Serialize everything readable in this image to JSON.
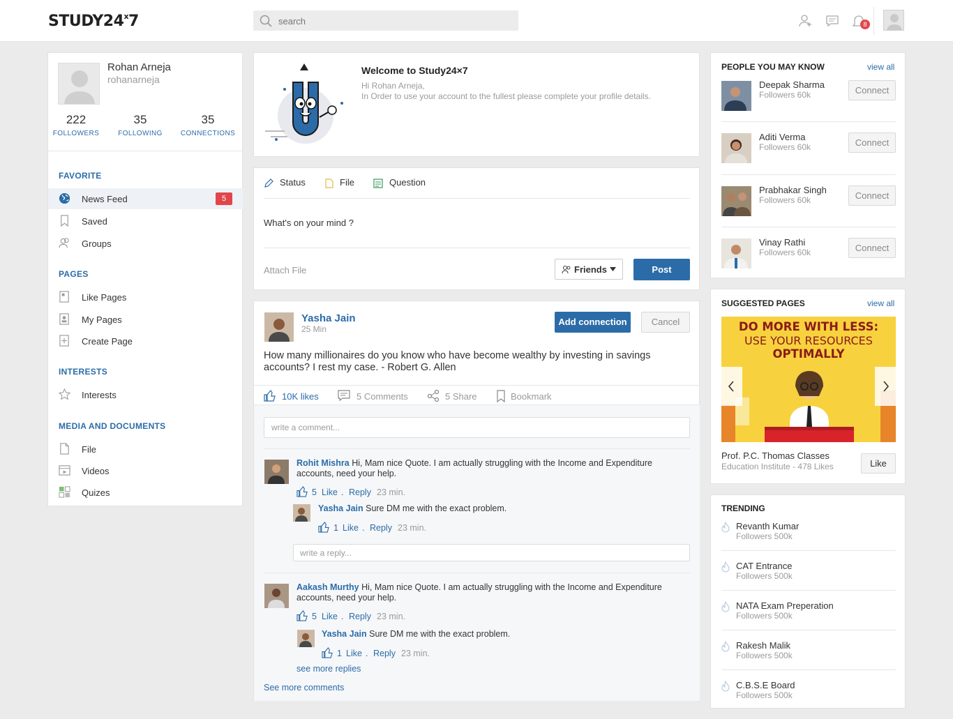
{
  "header": {
    "logo": "STUDY24",
    "logo_sup": "x",
    "logo_end": "7",
    "search_placeholder": "search",
    "notification_count": "8"
  },
  "profile": {
    "name": "Rohan Arneja",
    "username": "rohanarneja",
    "followers": "222",
    "followers_label": "FOLLOWERS",
    "following": "35",
    "following_label": "FOLLOWING",
    "connections": "35",
    "connections_label": "CONNECTIONS"
  },
  "sidebar": {
    "favorite_title": "FAVORITE",
    "news_feed": "News Feed",
    "news_feed_count": "5",
    "saved": "Saved",
    "groups": "Groups",
    "pages_title": "PAGES",
    "like_pages": "Like Pages",
    "my_pages": "My Pages",
    "create_page": "Create Page",
    "interests_title": "INTERESTS",
    "interests": "Interests",
    "media_title": "MEDIA AND DOCUMENTS",
    "file": "File",
    "videos": "Videos",
    "quizes": "Quizes"
  },
  "welcome": {
    "title": "Welcome to Study24×7",
    "line1": "Hi Rohan Arneja,",
    "line2": "In Order to use your account to the fullest please complete your profile details."
  },
  "composer": {
    "tab_status": "Status",
    "tab_file": "File",
    "tab_question": "Question",
    "placeholder": "What's on your mind ?",
    "attach": "Attach File",
    "audience": "Friends",
    "post": "Post"
  },
  "post": {
    "author": "Yasha Jain",
    "time": "25 Min",
    "add_connection": "Add connection",
    "cancel": "Cancel",
    "text": "How many millionaires do you know who have become wealthy by investing in savings accounts? I rest my case. - Robert G. Allen",
    "likes": "10K likes",
    "comments": "5 Comments",
    "shares": "5 Share",
    "bookmark": "Bookmark",
    "comment_placeholder": "write a comment...",
    "reply_placeholder": "write a reply...",
    "see_more_replies": "see more replies",
    "see_more_comments": "See more comments",
    "comments_list": [
      {
        "author": "Rohit Mishra",
        "text": "Hi, Mam nice Quote. I am actually struggling with the Income and Expenditure",
        "text2": "accounts, need your help.",
        "likes": "5",
        "like": "Like",
        "reply": "Reply",
        "time": "23 min.",
        "reply_author": "Yasha Jain",
        "reply_text": "Sure DM me with the exact problem.",
        "reply_likes": "1",
        "reply_time": "23 min."
      },
      {
        "author": "Aakash Murthy",
        "text": "Hi, Mam nice Quote. I am actually struggling with the Income and Expenditure",
        "text2": "accounts, need your help.",
        "likes": "5",
        "like": "Like",
        "reply": "Reply",
        "time": "23 min.",
        "reply_author": "Yasha Jain",
        "reply_text": "Sure DM me with the exact problem.",
        "reply_likes": "1",
        "reply_time": "23 min."
      }
    ],
    "dot": "."
  },
  "people": {
    "title": "PEOPLE YOU MAY KNOW",
    "view_all": "view all",
    "connect": "Connect",
    "list": [
      {
        "name": "Deepak Sharma",
        "followers": "Followers 60k"
      },
      {
        "name": "Aditi Verma",
        "followers": "Followers 60k"
      },
      {
        "name": "Prabhakar Singh",
        "followers": "Followers 60k"
      },
      {
        "name": "Vinay Rathi",
        "followers": "Followers 60k"
      }
    ]
  },
  "suggested": {
    "title": "SUGGESTED PAGES",
    "view_all": "view all",
    "banner1": "DO MORE WITH LESS:",
    "banner2": "USE YOUR RESOURCES",
    "banner3": "OPTIMALLY",
    "page_name": "Prof. P.C. Thomas Classes",
    "page_meta": "Education Institute - 478 Likes",
    "like": "Like"
  },
  "trending": {
    "title": "TRENDING",
    "list": [
      {
        "name": "Revanth Kumar",
        "followers": "Followers 500k"
      },
      {
        "name": "CAT Entrance",
        "followers": "Followers 500k"
      },
      {
        "name": "NATA Exam Preperation",
        "followers": "Followers 500k"
      },
      {
        "name": "Rakesh Malik",
        "followers": "Followers 500k"
      },
      {
        "name": "C.B.S.E Board",
        "followers": "Followers 500k"
      }
    ]
  },
  "colors": {
    "accent": "#2b6ca8",
    "badge": "#e0474c",
    "banner": "#f7d23e"
  }
}
